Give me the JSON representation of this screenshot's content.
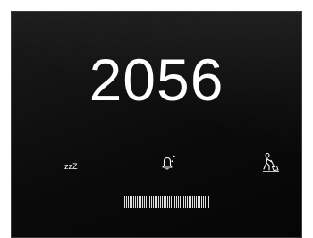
{
  "room": {
    "number": "2056"
  },
  "buttons": [
    {
      "id": "dnd",
      "icon": "sleep-zzz-icon",
      "label": "zzZ"
    },
    {
      "id": "bell",
      "icon": "doorbell-icon"
    },
    {
      "id": "clean",
      "icon": "housekeeping-cleaning-icon"
    }
  ],
  "colors": {
    "panel_background": "#0b0b0b",
    "text": "#ffffff",
    "frame": "#3a3a3a"
  }
}
